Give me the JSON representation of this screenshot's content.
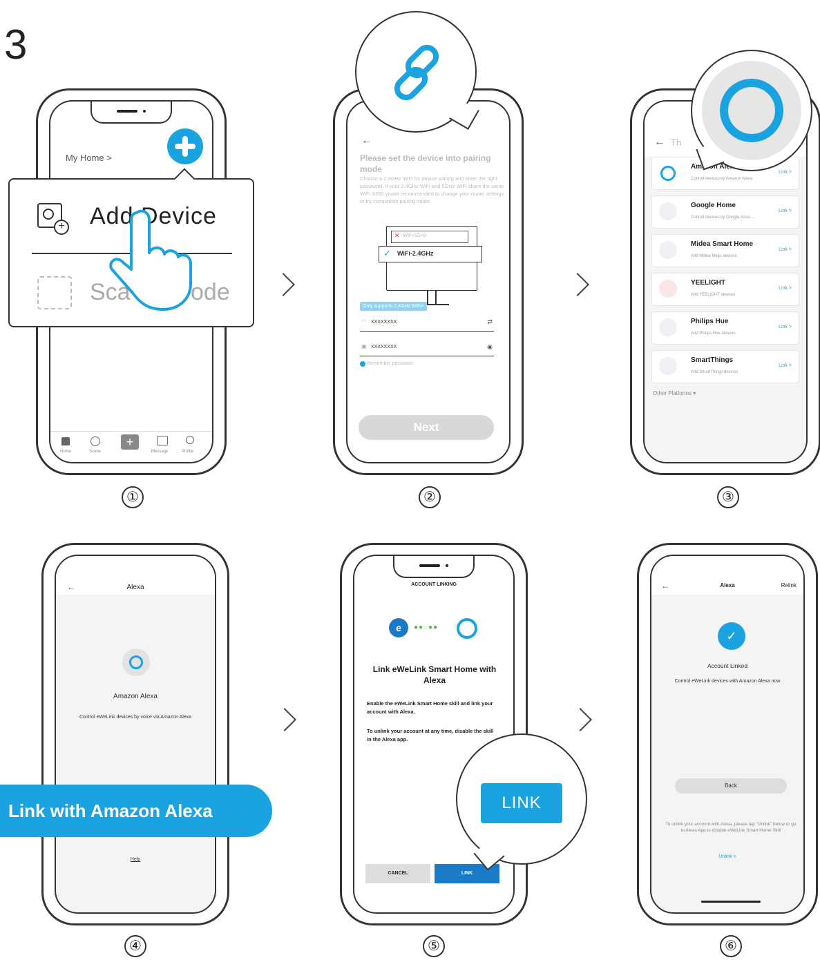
{
  "step_header": "3",
  "step_numbers": [
    "①",
    "②",
    "③",
    "④",
    "⑤",
    "⑥"
  ],
  "colors": {
    "accent": "#1ba2e0",
    "alexa_blue": "#2ba6e1",
    "link_btn": "#1a7ac7"
  },
  "screen1": {
    "home_label": "My Home >",
    "add_device": "Add Device",
    "scan_code": "Scan QR Code",
    "scan_visible_left": "Sca",
    "scan_visible_right": "ode",
    "nav": [
      "Home",
      "Scene",
      "",
      "Message",
      "Profile"
    ]
  },
  "screen2": {
    "title": "Please set the device into pairing mode",
    "desc": "Choose a 2.4GHz WiFi for device pairing and enter the right password. If your 2.4GHz WiFi and 5GHz WiFi share the same WiFi SSID,you're recommended to change your router settings or try compatible pairing mode.",
    "wifi_5g": "WiFi-5GHz",
    "wifi_24g": "WiFi-2.4GHz",
    "only_support": "Only supports 2.4GHz WiFi>",
    "ssid_value": "XXXXXXXX",
    "password_value": "XXXXXXXX",
    "remember": "Remember password",
    "next": "Next"
  },
  "screen3": {
    "back_text": "Th",
    "items": [
      {
        "title": "Amazon Alexa",
        "desc": "Control devices by Amazon Alexa",
        "link": "Link >"
      },
      {
        "title": "Google Home",
        "desc": "Control devices by Google Assis...",
        "link": "Link >"
      },
      {
        "title": "Midea Smart Home",
        "desc": "Add Midea Meiju devices",
        "link": "Link >"
      },
      {
        "title": "YEELIGHT",
        "desc": "Add YEELIGHT devices",
        "link": "Link >"
      },
      {
        "title": "Philips Hue",
        "desc": "Add Philips Hue devices",
        "link": "Link >"
      },
      {
        "title": "SmartThings",
        "desc": "Add SmartThings devices",
        "link": "Link >"
      }
    ],
    "other": "Other Platforms"
  },
  "screen4": {
    "title": "Alexa",
    "name": "Amazon Alexa",
    "desc": "Control eWeLink devices by voice via Amazon Alexa",
    "link_button": "Link with Amazon Alexa",
    "help": "Help"
  },
  "screen5": {
    "header": "ACCOUNT LINKING",
    "title": "Link eWeLink Smart Home with Alexa",
    "p1": "Enable the eWeLink Smart Home skill and link your account with Alexa.",
    "p2": "To unlink your account at any time, disable the skill in the Alexa app.",
    "cancel": "CANCEL",
    "link": "LINK",
    "callout": "LINK"
  },
  "screen6": {
    "title": "Alexa",
    "relink": "Relink",
    "linked": "Account Linked",
    "desc": "Control eWeLink devices with Amazon Alexa now",
    "back": "Back",
    "note": "To unlink your account with Alexa, please tap \"Unlink\" below or go to Alexa App to disable eWeLink Smart Home Skill",
    "unlink": "Unlink >"
  }
}
